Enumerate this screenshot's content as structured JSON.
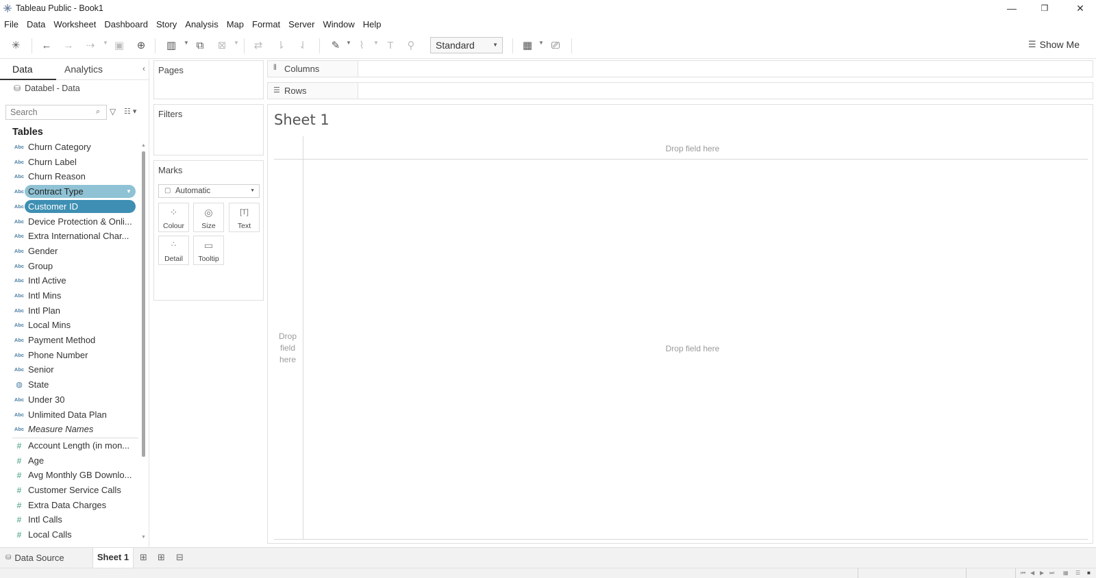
{
  "window": {
    "title": "Tableau Public - Book1",
    "minimize": "—",
    "restore": "❐",
    "close": "✕"
  },
  "menu": [
    "File",
    "Data",
    "Worksheet",
    "Dashboard",
    "Story",
    "Analysis",
    "Map",
    "Format",
    "Server",
    "Window",
    "Help"
  ],
  "toolbar": {
    "fit_select": "Standard",
    "show_me": "Show Me"
  },
  "data_pane": {
    "tab_data": "Data",
    "tab_analytics": "Analytics",
    "datasource": "Databel - Data",
    "search_placeholder": "Search",
    "tables_heading": "Tables",
    "dimension_type": "Abc",
    "fields": [
      {
        "name": "Churn Category",
        "type": "Abc"
      },
      {
        "name": "Churn Label",
        "type": "Abc"
      },
      {
        "name": "Churn Reason",
        "type": "Abc"
      },
      {
        "name": "Contract Type",
        "type": "Abc",
        "highlight": "light"
      },
      {
        "name": "Customer ID",
        "type": "Abc",
        "highlight": "dark"
      },
      {
        "name": "Device Protection & Onli...",
        "type": "Abc"
      },
      {
        "name": "Extra International Char...",
        "type": "Abc"
      },
      {
        "name": "Gender",
        "type": "Abc"
      },
      {
        "name": "Group",
        "type": "Abc"
      },
      {
        "name": "Intl Active",
        "type": "Abc"
      },
      {
        "name": "Intl Mins",
        "type": "Abc"
      },
      {
        "name": "Intl Plan",
        "type": "Abc"
      },
      {
        "name": "Local Mins",
        "type": "Abc"
      },
      {
        "name": "Payment Method",
        "type": "Abc"
      },
      {
        "name": "Phone Number",
        "type": "Abc"
      },
      {
        "name": "Senior",
        "type": "Abc"
      },
      {
        "name": "State",
        "type": "geo"
      },
      {
        "name": "Under 30",
        "type": "Abc"
      },
      {
        "name": "Unlimited Data Plan",
        "type": "Abc"
      },
      {
        "name": "Measure Names",
        "type": "Abc",
        "italic": true
      }
    ],
    "measures": [
      {
        "name": "Account Length (in mon...",
        "type": "#"
      },
      {
        "name": "Age",
        "type": "#"
      },
      {
        "name": "Avg Monthly GB Downlo...",
        "type": "#"
      },
      {
        "name": "Customer Service Calls",
        "type": "#"
      },
      {
        "name": "Extra Data Charges",
        "type": "#"
      },
      {
        "name": "Intl Calls",
        "type": "#"
      },
      {
        "name": "Local Calls",
        "type": "#"
      }
    ]
  },
  "cards": {
    "pages": "Pages",
    "filters": "Filters",
    "marks": "Marks",
    "mark_type": "Automatic",
    "mark_buttons": [
      "Colour",
      "Size",
      "Text",
      "Detail",
      "Tooltip"
    ]
  },
  "shelves": {
    "columns": "Columns",
    "rows": "Rows"
  },
  "viz": {
    "sheet_title": "Sheet 1",
    "drop_top": "Drop field here",
    "drop_center": "Drop field here",
    "drop_left": "Drop field here"
  },
  "bottom": {
    "data_source_tab": "Data Source",
    "sheet_tab": "Sheet 1"
  },
  "colors": {
    "pill_light": "#8ec2d4",
    "pill_dark": "#3e8fb3",
    "dimension_icon": "#4a7fa5",
    "measure_icon": "#3a9a7a"
  }
}
